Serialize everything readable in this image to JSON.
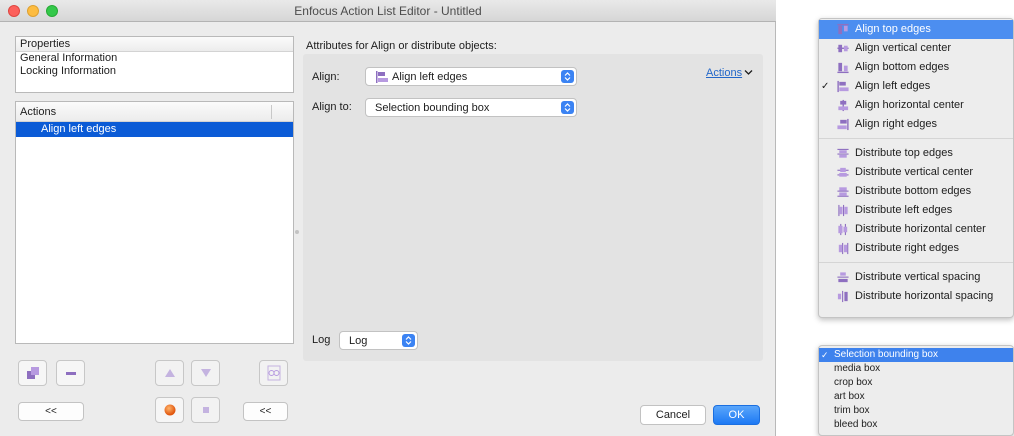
{
  "window": {
    "title": "Enfocus Action List Editor - Untitled"
  },
  "properties": {
    "header": "Properties",
    "rows": [
      "General Information",
      "Locking Information"
    ]
  },
  "actions": {
    "header": "Actions",
    "items": [
      {
        "label": "Align left edges",
        "selected": true
      }
    ]
  },
  "buttons": {
    "back_left": "<<",
    "back_right": "<<",
    "cancel": "Cancel",
    "ok": "OK"
  },
  "content": {
    "title": "Attributes for Align or distribute objects:",
    "align_label": "Align:",
    "align_value": "Align left edges",
    "align_to_label": "Align to:",
    "align_to_value": "Selection bounding box",
    "actions_link": "Actions",
    "log_label": "Log",
    "log_value": "Log"
  },
  "align_menu": {
    "groups": [
      [
        {
          "label": "Align top edges",
          "icon": "align-top-icon",
          "highlighted": true
        },
        {
          "label": "Align vertical center",
          "icon": "align-vertical-center-icon"
        },
        {
          "label": "Align bottom edges",
          "icon": "align-bottom-icon"
        },
        {
          "label": "Align left edges",
          "icon": "align-left-icon",
          "checked": true
        },
        {
          "label": "Align horizontal center",
          "icon": "align-horizontal-center-icon"
        },
        {
          "label": "Align right edges",
          "icon": "align-right-icon"
        }
      ],
      [
        {
          "label": "Distribute top edges",
          "icon": "distribute-top-icon"
        },
        {
          "label": "Distribute vertical center",
          "icon": "distribute-vertical-center-icon"
        },
        {
          "label": "Distribute bottom edges",
          "icon": "distribute-bottom-icon"
        },
        {
          "label": "Distribute left edges",
          "icon": "distribute-left-icon"
        },
        {
          "label": "Distribute horizontal center",
          "icon": "distribute-horizontal-center-icon"
        },
        {
          "label": "Distribute right edges",
          "icon": "distribute-right-icon"
        }
      ],
      [
        {
          "label": "Distribute vertical spacing",
          "icon": "distribute-vertical-spacing-icon"
        },
        {
          "label": "Distribute horizontal spacing",
          "icon": "distribute-horizontal-spacing-icon"
        }
      ]
    ]
  },
  "align_to_menu": {
    "items": [
      {
        "label": "Selection bounding box",
        "checked": true,
        "highlighted": true
      },
      {
        "label": "media box"
      },
      {
        "label": "crop box"
      },
      {
        "label": "art box"
      },
      {
        "label": "trim box"
      },
      {
        "label": "bleed box"
      }
    ]
  },
  "colors": {
    "selection": "#0b5bd6",
    "accent": "#3b83f3",
    "menu_highlight": "#4c8ef0",
    "icon_purple": "#8e6fc0",
    "link": "#2367c9"
  }
}
